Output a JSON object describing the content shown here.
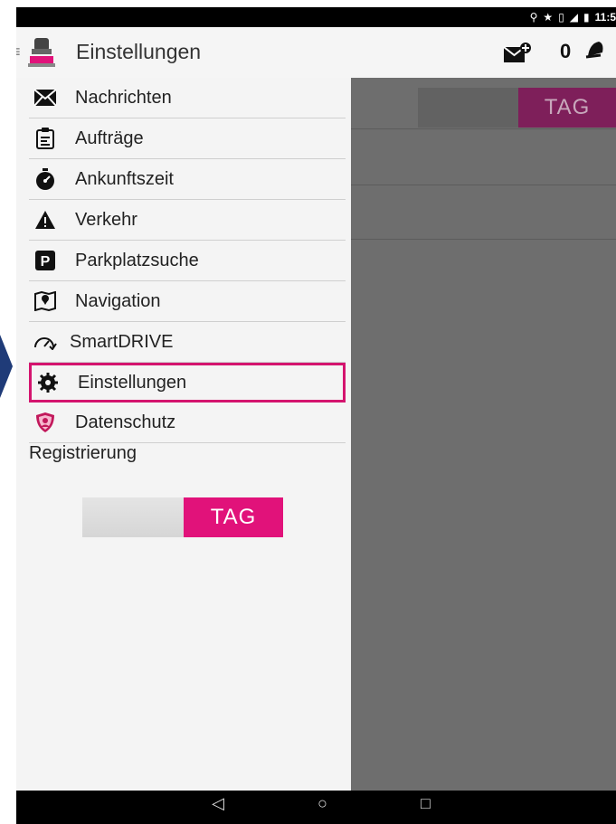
{
  "status_bar": {
    "time": "11:5"
  },
  "app_bar": {
    "title": "Einstellungen",
    "message_count": "0"
  },
  "menu": {
    "items": [
      {
        "label": "Nachrichten",
        "icon": "envelope-icon"
      },
      {
        "label": "Aufträge",
        "icon": "clipboard-icon"
      },
      {
        "label": "Ankunftszeit",
        "icon": "stopwatch-icon"
      },
      {
        "label": "Verkehr",
        "icon": "warning-icon"
      },
      {
        "label": "Parkplatzsuche",
        "icon": "parking-icon"
      },
      {
        "label": "Navigation",
        "icon": "map-pin-icon"
      },
      {
        "label": "SmartDRIVE",
        "icon": "speedometer-icon"
      },
      {
        "label": "Einstellungen",
        "icon": "gear-icon",
        "active": true
      },
      {
        "label": "Datenschutz",
        "icon": "shield-icon"
      }
    ],
    "registration": "Registrierung"
  },
  "mode_toggle": {
    "on_label": "TAG"
  },
  "background": {
    "toggle_label": "TAG"
  },
  "colors": {
    "accent": "#e1127a",
    "highlight_border": "#d4146e",
    "overlay": "#6e6e6e",
    "pointer": "#1f3b78"
  }
}
